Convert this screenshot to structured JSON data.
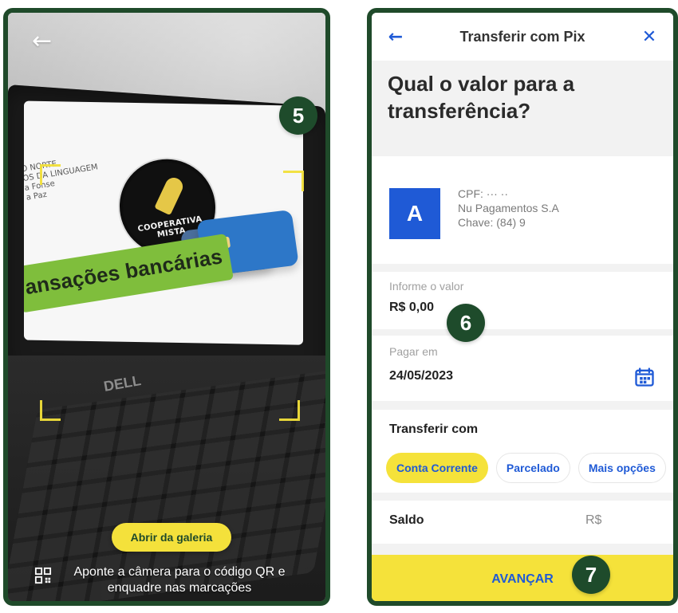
{
  "left_panel": {
    "back_icon": "arrow-left-icon",
    "step_badge": "5",
    "laptop": {
      "slide": {
        "left_lines": [
          "O NORTE",
          "OS DA LINGUAGEM",
          "a Fonse",
          "a Paz"
        ],
        "logo_text": "COOPERATIVA MISTA",
        "band_text": "ansações bancárias"
      },
      "brand": "DELL"
    },
    "gallery_button_label": "Abrir da galeria",
    "qr_icon": "qr-code-icon",
    "instructions": "Aponte a câmera para o código QR e enquadre nas marcações"
  },
  "right_panel": {
    "topbar": {
      "back_icon": "arrow-left-icon",
      "title": "Transferir com Pix",
      "close_icon": "close-icon"
    },
    "question": "Qual o valor para a\ntransferência?",
    "recipient": {
      "avatar_letter": "A",
      "lines": [
        "CPF: ···          ··",
        "Nu Pagamentos S.A.",
        "Chave: (84) 9"
      ]
    },
    "amount": {
      "label": "Informe o valor",
      "value": "R$ 0,00",
      "step_badge": "6"
    },
    "payment_date": {
      "label": "Pagar em",
      "value": "24/05/2023",
      "calendar_icon": "calendar-icon"
    },
    "transfer_with": {
      "title": "Transferir com",
      "options": [
        {
          "label": "Conta Corrente",
          "selected": true
        },
        {
          "label": "Parcelado",
          "selected": false
        },
        {
          "label": "Mais opções",
          "selected": false
        }
      ],
      "saldo_label": "Saldo",
      "saldo_value": "R$"
    },
    "advance_button_label": "AVANÇAR",
    "step_badge_bottom": "7"
  },
  "colors": {
    "frame_green": "#1f4a2a",
    "accent_yellow": "#f5e23a",
    "primary_blue": "#1f5ad6"
  }
}
